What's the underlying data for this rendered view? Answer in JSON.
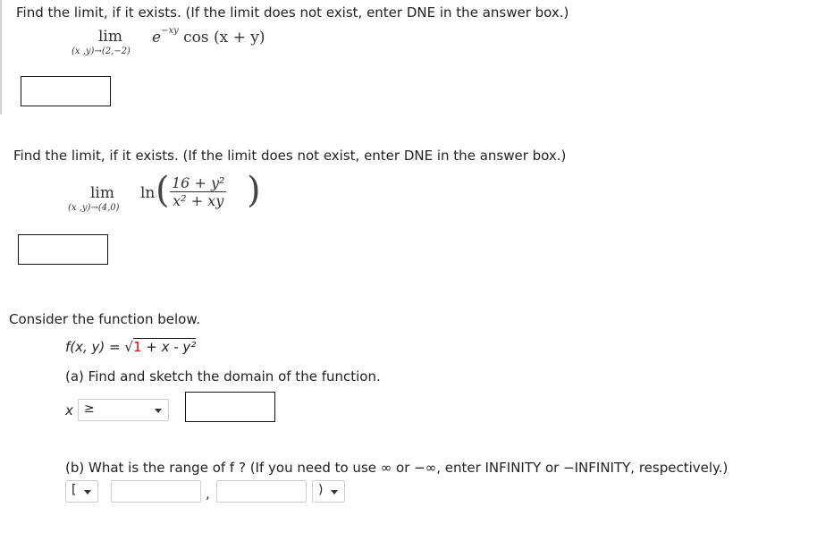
{
  "q1": {
    "prompt": "Find the limit, if it exists. (If the limit does not exist, enter DNE in the answer box.)",
    "lim_word": "lim",
    "lim_sub": "(x ,y)→(2,−2)",
    "expr_base": "e",
    "expr_exp": "−xy",
    "expr_rest": "cos (x  +  y)",
    "answer": ""
  },
  "q2": {
    "prompt": "Find the limit, if it exists. (If the limit does not exist, enter DNE in the answer box.)",
    "lim_word": "lim",
    "lim_sub": "(x ,y)→(4,0)",
    "ln": "ln",
    "numerator": "16  +  y²",
    "denominator": "x²  +  xy",
    "paren_open": "(",
    "paren_close": ")",
    "answer": ""
  },
  "q3": {
    "intro": "Consider the function below.",
    "func_lhs": "f(x, y) = ",
    "sqrt_sign": "√",
    "radicand_highlight": "1",
    "radicand_rest": " + x - y²",
    "part_a": "(a) Find and sketch the domain of the function.",
    "domain_var": "x",
    "domain_relation_selected": "≥",
    "domain_value": "",
    "part_b": "(b) What is the range of f ? (If you need to use ∞ or −∞, enter INFINITY or −INFINITY, respectively.)",
    "range_left_bracket_selected": "[",
    "range_lower": "",
    "range_separator": ",",
    "range_upper": "",
    "range_right_bracket_selected": ")",
    "highlight_color": "#e00000"
  }
}
